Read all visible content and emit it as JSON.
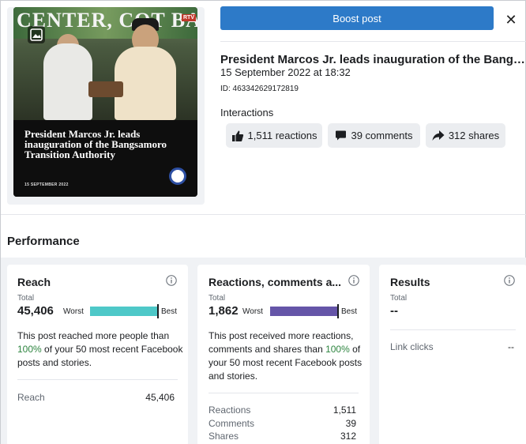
{
  "thumbnail": {
    "banner_text": "CENTER, COT BATO",
    "year_text": "20",
    "caption": "President Marcos Jr. leads inauguration of the Bangsamoro Transition Authority",
    "date": "15 SEPTEMBER 2022",
    "logo_text": "RTV"
  },
  "header": {
    "boost_label": "Boost post",
    "close_label": "✕"
  },
  "post": {
    "title": "President Marcos Jr. leads inauguration of the Bangsamoro Transition Authority",
    "date": "15 September 2022 at 18:32",
    "id": "ID: 463342629172819",
    "interactions_label": "Interactions"
  },
  "interactions": {
    "reactions": "1,511 reactions",
    "comments": "39 comments",
    "shares": "312 shares"
  },
  "performance": {
    "title": "Performance",
    "reach": {
      "title": "Reach",
      "total_label": "Total",
      "total": "45,406",
      "worst": "Worst",
      "best": "Best",
      "bar_fill": 1.0,
      "bar_color": "#4ec8c8",
      "desc_pre": "This post reached more people than ",
      "desc_pct": "100%",
      "desc_post": " of your 50 most recent Facebook posts and stories.",
      "rows": [
        {
          "label": "Reach",
          "value": "45,406"
        }
      ]
    },
    "engagement": {
      "title": "Reactions, comments a...",
      "total_label": "Total",
      "total": "1,862",
      "worst": "Worst",
      "best": "Best",
      "bar_fill": 1.0,
      "bar_color": "#6555a8",
      "desc_pre": "This post received more reactions, comments and shares than ",
      "desc_pct": "100%",
      "desc_post": " of your 50 most recent Facebook posts and stories.",
      "rows": [
        {
          "label": "Reactions",
          "value": "1,511"
        },
        {
          "label": "Comments",
          "value": "39"
        },
        {
          "label": "Shares",
          "value": "312"
        }
      ]
    },
    "results": {
      "title": "Results",
      "total_label": "Total",
      "total": "--",
      "rows": [
        {
          "label": "Link clicks",
          "value": "--"
        }
      ]
    }
  },
  "colors": {
    "accent": "#2d7ac8",
    "positive": "#2e8540"
  }
}
